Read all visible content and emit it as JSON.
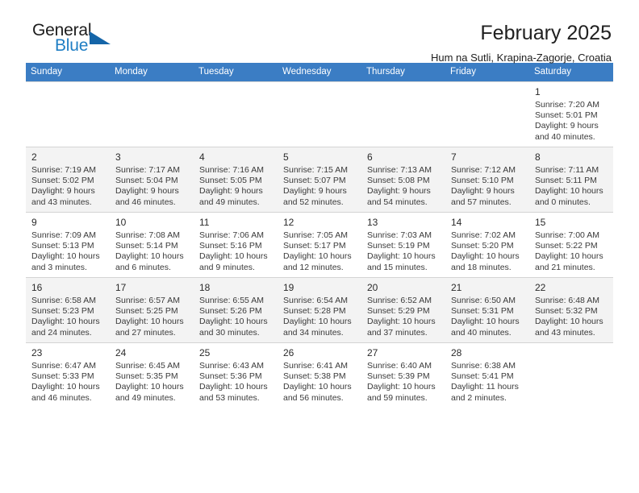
{
  "brand": {
    "name_part1": "General",
    "name_part2": "Blue",
    "triangle_icon": "triangle-logo-icon",
    "accent_color": "#1f7ec4"
  },
  "header": {
    "title": "February 2025",
    "subtitle": "Hum na Sutli, Krapina-Zagorje, Croatia"
  },
  "calendar": {
    "header_bg": "#3b7dc4",
    "weekday_headers": [
      "Sunday",
      "Monday",
      "Tuesday",
      "Wednesday",
      "Thursday",
      "Friday",
      "Saturday"
    ],
    "weeks": [
      {
        "shaded": false,
        "days": [
          {
            "empty": true
          },
          {
            "empty": true
          },
          {
            "empty": true
          },
          {
            "empty": true
          },
          {
            "empty": true
          },
          {
            "empty": true
          },
          {
            "empty": false,
            "day": "1",
            "sunrise": "Sunrise: 7:20 AM",
            "sunset": "Sunset: 5:01 PM",
            "daylight_line1": "Daylight: 9 hours",
            "daylight_line2": "and 40 minutes."
          }
        ]
      },
      {
        "shaded": true,
        "days": [
          {
            "empty": false,
            "day": "2",
            "sunrise": "Sunrise: 7:19 AM",
            "sunset": "Sunset: 5:02 PM",
            "daylight_line1": "Daylight: 9 hours",
            "daylight_line2": "and 43 minutes."
          },
          {
            "empty": false,
            "day": "3",
            "sunrise": "Sunrise: 7:17 AM",
            "sunset": "Sunset: 5:04 PM",
            "daylight_line1": "Daylight: 9 hours",
            "daylight_line2": "and 46 minutes."
          },
          {
            "empty": false,
            "day": "4",
            "sunrise": "Sunrise: 7:16 AM",
            "sunset": "Sunset: 5:05 PM",
            "daylight_line1": "Daylight: 9 hours",
            "daylight_line2": "and 49 minutes."
          },
          {
            "empty": false,
            "day": "5",
            "sunrise": "Sunrise: 7:15 AM",
            "sunset": "Sunset: 5:07 PM",
            "daylight_line1": "Daylight: 9 hours",
            "daylight_line2": "and 52 minutes."
          },
          {
            "empty": false,
            "day": "6",
            "sunrise": "Sunrise: 7:13 AM",
            "sunset": "Sunset: 5:08 PM",
            "daylight_line1": "Daylight: 9 hours",
            "daylight_line2": "and 54 minutes."
          },
          {
            "empty": false,
            "day": "7",
            "sunrise": "Sunrise: 7:12 AM",
            "sunset": "Sunset: 5:10 PM",
            "daylight_line1": "Daylight: 9 hours",
            "daylight_line2": "and 57 minutes."
          },
          {
            "empty": false,
            "day": "8",
            "sunrise": "Sunrise: 7:11 AM",
            "sunset": "Sunset: 5:11 PM",
            "daylight_line1": "Daylight: 10 hours",
            "daylight_line2": "and 0 minutes."
          }
        ]
      },
      {
        "shaded": false,
        "days": [
          {
            "empty": false,
            "day": "9",
            "sunrise": "Sunrise: 7:09 AM",
            "sunset": "Sunset: 5:13 PM",
            "daylight_line1": "Daylight: 10 hours",
            "daylight_line2": "and 3 minutes."
          },
          {
            "empty": false,
            "day": "10",
            "sunrise": "Sunrise: 7:08 AM",
            "sunset": "Sunset: 5:14 PM",
            "daylight_line1": "Daylight: 10 hours",
            "daylight_line2": "and 6 minutes."
          },
          {
            "empty": false,
            "day": "11",
            "sunrise": "Sunrise: 7:06 AM",
            "sunset": "Sunset: 5:16 PM",
            "daylight_line1": "Daylight: 10 hours",
            "daylight_line2": "and 9 minutes."
          },
          {
            "empty": false,
            "day": "12",
            "sunrise": "Sunrise: 7:05 AM",
            "sunset": "Sunset: 5:17 PM",
            "daylight_line1": "Daylight: 10 hours",
            "daylight_line2": "and 12 minutes."
          },
          {
            "empty": false,
            "day": "13",
            "sunrise": "Sunrise: 7:03 AM",
            "sunset": "Sunset: 5:19 PM",
            "daylight_line1": "Daylight: 10 hours",
            "daylight_line2": "and 15 minutes."
          },
          {
            "empty": false,
            "day": "14",
            "sunrise": "Sunrise: 7:02 AM",
            "sunset": "Sunset: 5:20 PM",
            "daylight_line1": "Daylight: 10 hours",
            "daylight_line2": "and 18 minutes."
          },
          {
            "empty": false,
            "day": "15",
            "sunrise": "Sunrise: 7:00 AM",
            "sunset": "Sunset: 5:22 PM",
            "daylight_line1": "Daylight: 10 hours",
            "daylight_line2": "and 21 minutes."
          }
        ]
      },
      {
        "shaded": true,
        "days": [
          {
            "empty": false,
            "day": "16",
            "sunrise": "Sunrise: 6:58 AM",
            "sunset": "Sunset: 5:23 PM",
            "daylight_line1": "Daylight: 10 hours",
            "daylight_line2": "and 24 minutes."
          },
          {
            "empty": false,
            "day": "17",
            "sunrise": "Sunrise: 6:57 AM",
            "sunset": "Sunset: 5:25 PM",
            "daylight_line1": "Daylight: 10 hours",
            "daylight_line2": "and 27 minutes."
          },
          {
            "empty": false,
            "day": "18",
            "sunrise": "Sunrise: 6:55 AM",
            "sunset": "Sunset: 5:26 PM",
            "daylight_line1": "Daylight: 10 hours",
            "daylight_line2": "and 30 minutes."
          },
          {
            "empty": false,
            "day": "19",
            "sunrise": "Sunrise: 6:54 AM",
            "sunset": "Sunset: 5:28 PM",
            "daylight_line1": "Daylight: 10 hours",
            "daylight_line2": "and 34 minutes."
          },
          {
            "empty": false,
            "day": "20",
            "sunrise": "Sunrise: 6:52 AM",
            "sunset": "Sunset: 5:29 PM",
            "daylight_line1": "Daylight: 10 hours",
            "daylight_line2": "and 37 minutes."
          },
          {
            "empty": false,
            "day": "21",
            "sunrise": "Sunrise: 6:50 AM",
            "sunset": "Sunset: 5:31 PM",
            "daylight_line1": "Daylight: 10 hours",
            "daylight_line2": "and 40 minutes."
          },
          {
            "empty": false,
            "day": "22",
            "sunrise": "Sunrise: 6:48 AM",
            "sunset": "Sunset: 5:32 PM",
            "daylight_line1": "Daylight: 10 hours",
            "daylight_line2": "and 43 minutes."
          }
        ]
      },
      {
        "shaded": false,
        "days": [
          {
            "empty": false,
            "day": "23",
            "sunrise": "Sunrise: 6:47 AM",
            "sunset": "Sunset: 5:33 PM",
            "daylight_line1": "Daylight: 10 hours",
            "daylight_line2": "and 46 minutes."
          },
          {
            "empty": false,
            "day": "24",
            "sunrise": "Sunrise: 6:45 AM",
            "sunset": "Sunset: 5:35 PM",
            "daylight_line1": "Daylight: 10 hours",
            "daylight_line2": "and 49 minutes."
          },
          {
            "empty": false,
            "day": "25",
            "sunrise": "Sunrise: 6:43 AM",
            "sunset": "Sunset: 5:36 PM",
            "daylight_line1": "Daylight: 10 hours",
            "daylight_line2": "and 53 minutes."
          },
          {
            "empty": false,
            "day": "26",
            "sunrise": "Sunrise: 6:41 AM",
            "sunset": "Sunset: 5:38 PM",
            "daylight_line1": "Daylight: 10 hours",
            "daylight_line2": "and 56 minutes."
          },
          {
            "empty": false,
            "day": "27",
            "sunrise": "Sunrise: 6:40 AM",
            "sunset": "Sunset: 5:39 PM",
            "daylight_line1": "Daylight: 10 hours",
            "daylight_line2": "and 59 minutes."
          },
          {
            "empty": false,
            "day": "28",
            "sunrise": "Sunrise: 6:38 AM",
            "sunset": "Sunset: 5:41 PM",
            "daylight_line1": "Daylight: 11 hours",
            "daylight_line2": "and 2 minutes."
          },
          {
            "empty": true
          }
        ]
      }
    ]
  }
}
